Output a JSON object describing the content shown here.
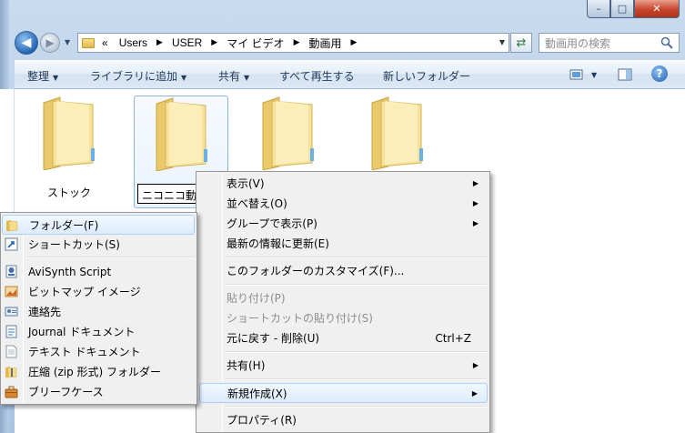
{
  "window": {
    "caption": {
      "minimize": "–",
      "maximize": "□",
      "close": "✕"
    }
  },
  "nav": {
    "back": "◀",
    "forward": "▶",
    "dropdown": "▼"
  },
  "address": {
    "prefix": "«",
    "crumbs": [
      "Users",
      "USER",
      "マイ ビデオ",
      "動画用"
    ],
    "separator": "▶",
    "dropdown": "▼"
  },
  "refresh_icon": "⇄",
  "search": {
    "placeholder": "動画用の検索"
  },
  "toolbar": {
    "organize": "整理",
    "add_to_library": "ライブラリに追加",
    "share": "共有",
    "play_all": "すべて再生する",
    "new_folder": "新しいフォルダー",
    "arrow": "▼",
    "help": "?"
  },
  "folders": [
    {
      "label": "ストック"
    },
    {
      "label": "ニコニコ動画"
    },
    {
      "label": ""
    },
    {
      "label": ""
    }
  ],
  "context_menu": {
    "arrow": "▶",
    "items": [
      {
        "label": "表示(V)",
        "submenu": true
      },
      {
        "label": "並べ替え(O)",
        "submenu": true
      },
      {
        "label": "グループで表示(P)",
        "submenu": true
      },
      {
        "label": "最新の情報に更新(E)"
      },
      {
        "label": "このフォルダーのカスタマイズ(F)..."
      },
      {
        "label": "貼り付け(P)",
        "disabled": true
      },
      {
        "label": "ショートカットの貼り付け(S)",
        "disabled": true
      },
      {
        "label": "元に戻す - 削除(U)",
        "shortcut": "Ctrl+Z"
      },
      {
        "label": "共有(H)",
        "submenu": true
      },
      {
        "label": "新規作成(X)",
        "submenu": true
      },
      {
        "label": "プロパティ(R)"
      }
    ]
  },
  "new_submenu": {
    "items": [
      {
        "label": "フォルダー(F)",
        "icon": "folder-icon"
      },
      {
        "label": "ショートカット(S)",
        "icon": "shortcut-icon"
      },
      {
        "label": "AviSynth Script",
        "icon": "avisynth-icon"
      },
      {
        "label": "ビットマップ イメージ",
        "icon": "bitmap-icon"
      },
      {
        "label": "連絡先",
        "icon": "contact-icon"
      },
      {
        "label": "Journal ドキュメント",
        "icon": "journal-icon"
      },
      {
        "label": "テキスト ドキュメント",
        "icon": "text-document-icon"
      },
      {
        "label": "圧縮 (zip 形式) フォルダー",
        "icon": "zip-folder-icon"
      },
      {
        "label": "ブリーフケース",
        "icon": "briefcase-icon"
      }
    ]
  }
}
